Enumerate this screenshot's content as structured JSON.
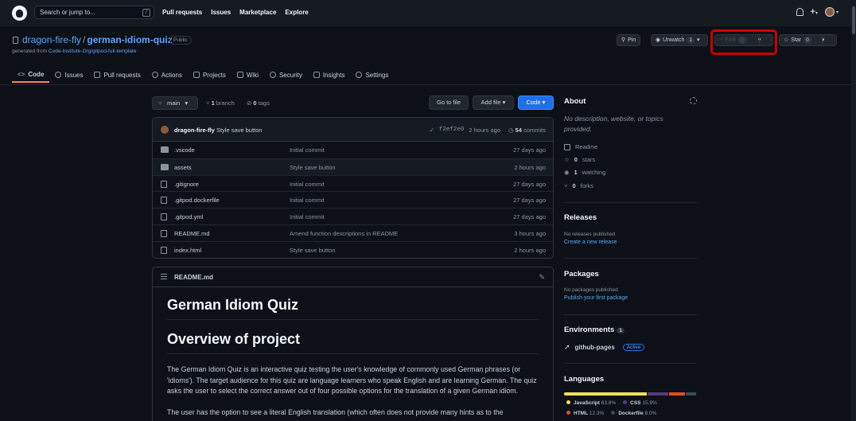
{
  "topbar": {
    "search_placeholder": "Search or jump to...",
    "search_key": "/",
    "nav": [
      "Pull requests",
      "Issues",
      "Marketplace",
      "Explore"
    ]
  },
  "repo": {
    "owner": "dragon-fire-fly",
    "slash": "/",
    "name": "german-idiom-quiz",
    "visibility": "Public",
    "generated_prefix": "generated from",
    "template": "Code-Institute-Org/gitpod-full-template"
  },
  "actions": {
    "pin": "Pin",
    "unwatch": "Unwatch",
    "watch_count": "1",
    "fork": "Fork",
    "fork_count": "0",
    "star": "Star",
    "star_count": "0"
  },
  "tabs": [
    "Code",
    "Issues",
    "Pull requests",
    "Actions",
    "Projects",
    "Wiki",
    "Security",
    "Insights",
    "Settings"
  ],
  "toolbar": {
    "branch": "main",
    "branches_count": "1",
    "branches_label": "branch",
    "tags_count": "0",
    "tags_label": "tags",
    "go_to_file": "Go to file",
    "add_file": "Add file",
    "code": "Code"
  },
  "commit": {
    "author": "dragon-fire-fly",
    "message": "Style save button",
    "sha": "f2ef2e0",
    "time": "2 hours ago",
    "commits_count": "54",
    "commits_label": "commits"
  },
  "files": [
    {
      "name": ".vscode",
      "type": "folder",
      "message": "Initial commit",
      "time": "27 days ago"
    },
    {
      "name": "assets",
      "type": "folder",
      "message": "Style save button",
      "time": "2 hours ago"
    },
    {
      "name": ".gitignore",
      "type": "file",
      "message": "Initial commit",
      "time": "27 days ago"
    },
    {
      "name": ".gitpod.dockerfile",
      "type": "file",
      "message": "Initial commit",
      "time": "27 days ago"
    },
    {
      "name": ".gitpod.yml",
      "type": "file",
      "message": "Initial commit",
      "time": "27 days ago"
    },
    {
      "name": "README.md",
      "type": "file",
      "message": "Amend function descriptions in README",
      "time": "3 hours ago"
    },
    {
      "name": "index.html",
      "type": "file",
      "message": "Style save button",
      "time": "2 hours ago"
    }
  ],
  "readme": {
    "filename": "README.md",
    "h1": "German Idiom Quiz",
    "h2": "Overview of project",
    "p1": "The German Idiom Quiz is an interactive quiz testing the user's knowledge of commonly used German phrases (or 'idioms'). The target audience for this quiz are language learners who speak English and are learning German. The quiz asks the user to select the correct answer out of four possible options for the translation of a given German idiom.",
    "p2": "The user has the option to see a literal English translation (which often does not provide many hints as to the"
  },
  "about": {
    "heading": "About",
    "description": "No description, website, or topics provided.",
    "readme": "Readme",
    "stars_count": "0",
    "stars_label": "stars",
    "watching_count": "1",
    "watching_label": "watching",
    "forks_count": "0",
    "forks_label": "forks"
  },
  "releases": {
    "heading": "Releases",
    "text": "No releases published",
    "link": "Create a new release"
  },
  "packages": {
    "heading": "Packages",
    "text": "No packages published",
    "link": "Publish your first package"
  },
  "environments": {
    "heading": "Environments",
    "count": "1",
    "name": "github-pages",
    "status": "Active"
  },
  "languages": {
    "heading": "Languages",
    "items": [
      {
        "name": "JavaScript",
        "percent": "63.8%",
        "value": 63.8,
        "color": "#f1e05a"
      },
      {
        "name": "CSS",
        "percent": "15.9%",
        "value": 15.9,
        "color": "#563d7c"
      },
      {
        "name": "HTML",
        "percent": "12.3%",
        "value": 12.3,
        "color": "#e34c26"
      },
      {
        "name": "Dockerfile",
        "percent": "8.0%",
        "value": 8.0,
        "color": "#384d54"
      }
    ]
  }
}
